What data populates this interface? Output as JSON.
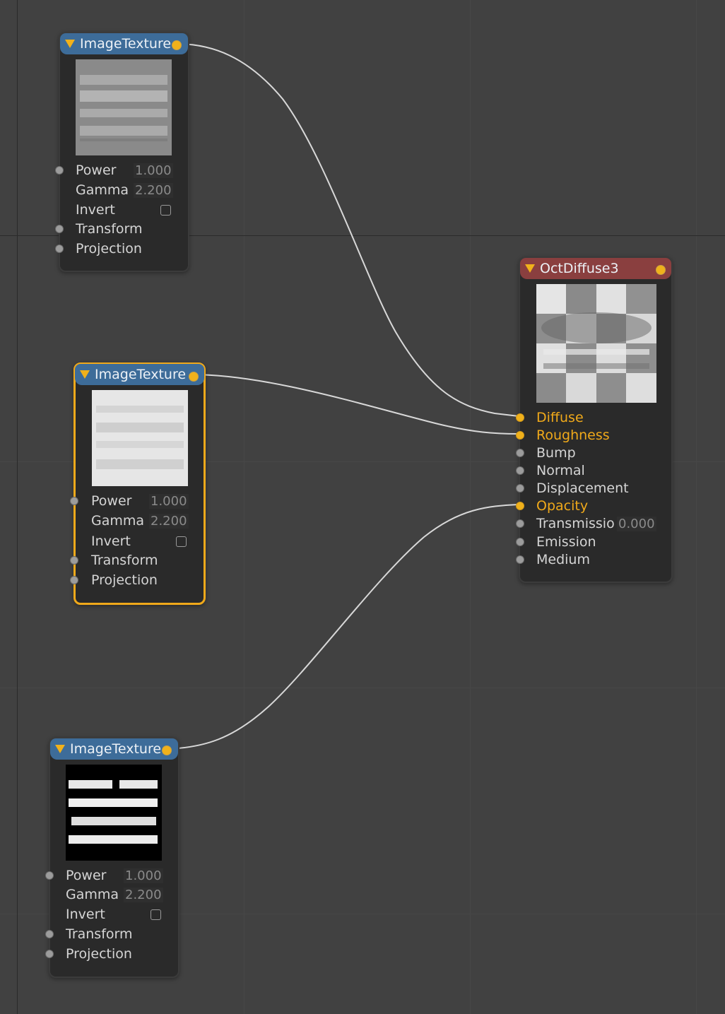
{
  "nodes": {
    "tex1": {
      "title": "ImageTexture",
      "power_label": "Power",
      "power_value": "1.000",
      "gamma_label": "Gamma",
      "gamma_value": "2.200",
      "invert_label": "Invert",
      "transform_label": "Transform",
      "projection_label": "Projection"
    },
    "tex2": {
      "title": "ImageTexture",
      "power_label": "Power",
      "power_value": "1.000",
      "gamma_label": "Gamma",
      "gamma_value": "2.200",
      "invert_label": "Invert",
      "transform_label": "Transform",
      "projection_label": "Projection"
    },
    "tex3": {
      "title": "ImageTexture",
      "power_label": "Power",
      "power_value": "1.000",
      "gamma_label": "Gamma",
      "gamma_value": "2.200",
      "invert_label": "Invert",
      "transform_label": "Transform",
      "projection_label": "Projection"
    },
    "diffuse": {
      "title": "OctDiffuse3",
      "inputs": {
        "diffuse": "Diffuse",
        "roughness": "Roughness",
        "bump": "Bump",
        "normal": "Normal",
        "displacement": "Displacement",
        "opacity": "Opacity",
        "transmission": "Transmissio",
        "transmission_value": "0.000",
        "emission": "Emission",
        "medium": "Medium"
      }
    }
  },
  "colors": {
    "background": "#414141",
    "node_body": "#2a2a2a",
    "texture_header": "#3d6c99",
    "material_header": "#8a3f3f",
    "accent": "#f0a91a",
    "wire": "#d8d8d8"
  }
}
